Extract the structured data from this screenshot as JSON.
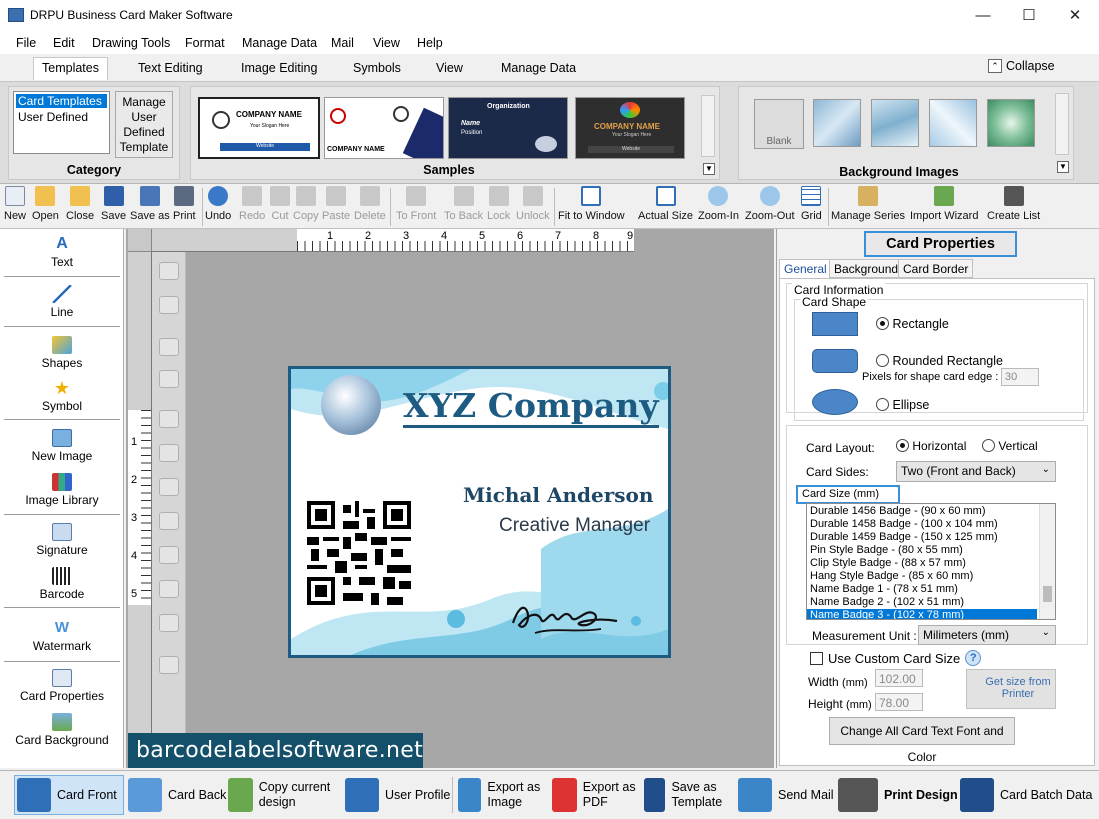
{
  "window": {
    "title": "DRPU Business Card Maker Software",
    "minimize": "—",
    "maximize": "☐",
    "close": "✕"
  },
  "menu": [
    "File",
    "Edit",
    "Drawing Tools",
    "Format",
    "Manage Data",
    "Mail",
    "View",
    "Help"
  ],
  "ribbon_tabs": [
    "Templates",
    "Text Editing",
    "Image Editing",
    "Symbols",
    "View",
    "Manage Data"
  ],
  "collapse_label": "Collapse",
  "category": {
    "label": "Category",
    "items": [
      "Card Templates",
      "User Defined"
    ],
    "manage_button": "Manage User Defined Template"
  },
  "samples": {
    "label": "Samples",
    "thumbs": [
      {
        "line1": "COMPANY NAME",
        "line2": "Your Slogan Here",
        "line3": "Website"
      },
      {
        "line1": "COMPANY NAME"
      },
      {
        "line1": "Organization",
        "line2": "Name",
        "line3": "Position"
      },
      {
        "line1": "COMPANY NAME",
        "line2": "Your Slogan Here",
        "line3": "Website"
      }
    ]
  },
  "background_images": {
    "label": "Background Images",
    "first_thumb": "Blank"
  },
  "toolbar": {
    "group1": [
      "New",
      "Open",
      "Close",
      "Save",
      "Save as",
      "Print"
    ],
    "group2": [
      "Undo",
      "Redo",
      "Cut",
      "Copy",
      "Paste",
      "Delete"
    ],
    "group3": [
      "To Front",
      "To Back",
      "Lock",
      "Unlock"
    ],
    "group4": [
      "Fit to Window",
      "Actual Size",
      "Zoom-In",
      "Zoom-Out",
      "Grid"
    ],
    "group5": [
      "Manage Series",
      "Import Wizard",
      "Create List"
    ]
  },
  "left_tools": [
    "Text",
    "Line",
    "Shapes",
    "Symbol",
    "New Image",
    "Image Library",
    "Signature",
    "Barcode",
    "Watermark",
    "Card Properties",
    "Card Background"
  ],
  "watermark_site": "barcodelabelsoftware.net",
  "ruler": {
    "h": [
      "1",
      "2",
      "3",
      "4",
      "5",
      "6",
      "7",
      "8",
      "9"
    ],
    "v": [
      "1",
      "2",
      "3",
      "4",
      "5"
    ]
  },
  "card": {
    "company": "XYZ Company",
    "name": "Michal Anderson",
    "title": "Creative Manager"
  },
  "card_properties": {
    "header": "Card Properties",
    "tabs": [
      "General",
      "Background",
      "Card Border"
    ],
    "card_information": "Card Information",
    "card_shape": "Card Shape",
    "shapes": [
      "Rectangle",
      "Rounded Rectangle",
      "Ellipse"
    ],
    "pixels_label": "Pixels for shape card edge :",
    "pixels_value": "30",
    "layout_label": "Card Layout:",
    "layout_options": [
      "Horizontal",
      "Vertical"
    ],
    "sides_label": "Card Sides:",
    "sides_value": "Two (Front and Back)",
    "size_label": "Card Size (mm)",
    "sizes": [
      "Durable 1456  Badge  -   (90 x 60 mm)",
      "Durable 1458  Badge  -   (100 x 104 mm)",
      "Durable 1459  Badge  -   (150 x 125 mm)",
      "Pin Style Badge  -   (80 x 55 mm)",
      "Clip Style Badge  -   (88 x 57 mm)",
      "Hang Style Badge  -   (85 x 60 mm)",
      "Name Badge 1  -   (78 x 51 mm)",
      "Name Badge 2  -   (102 x 51 mm)",
      "Name Badge 3  -   (102 x 78 mm)"
    ],
    "measurement_label": "Measurement Unit :",
    "measurement_value": "Milimeters (mm)",
    "custom_size_label": "Use Custom Card Size",
    "width_label": "Width",
    "height_label": "Height",
    "unit": "(mm)",
    "width_value": "102.00",
    "height_value": "78.00",
    "get_size": "Get size from Printer",
    "change_all": "Change All Card Text Font and Color"
  },
  "bottom": [
    "Card Front",
    "Card Back",
    "Copy current design",
    "User Profile",
    "Export as Image",
    "Export as PDF",
    "Save as Template",
    "Send Mail",
    "Print Design",
    "Card Batch Data"
  ]
}
